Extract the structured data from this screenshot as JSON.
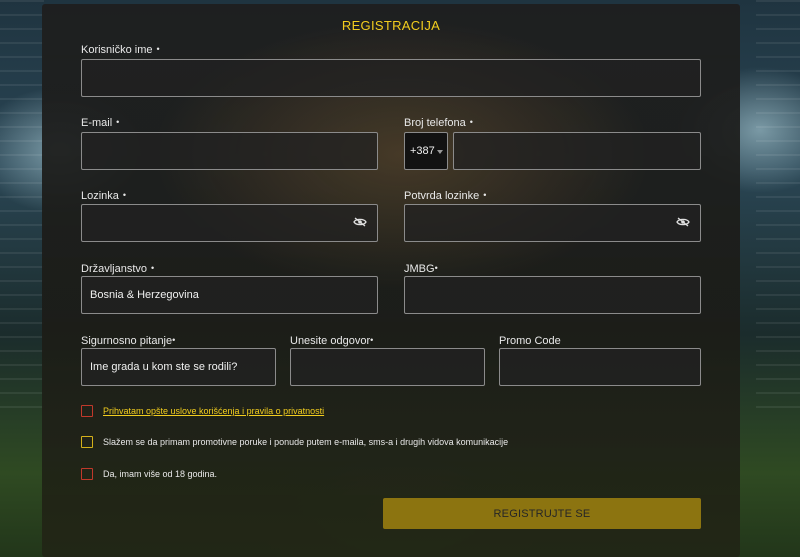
{
  "form": {
    "title": "REGISTRACIJA",
    "username": {
      "label": "Korisničko ime",
      "value": ""
    },
    "email": {
      "label": "E-mail",
      "value": ""
    },
    "phone": {
      "label": "Broj telefona",
      "prefix": "+387",
      "value": ""
    },
    "password": {
      "label": "Lozinka",
      "value": ""
    },
    "password_confirm": {
      "label": "Potvrda lozinke",
      "value": ""
    },
    "citizenship": {
      "label": "Državljanstvo",
      "value": "Bosnia & Herzegovina"
    },
    "jmbg": {
      "label": "JMBG",
      "value": ""
    },
    "security_question": {
      "label": "Sigurnosno pitanje",
      "value": "Ime grada u kom ste se rodili?"
    },
    "answer": {
      "label": "Unesite odgovor",
      "value": ""
    },
    "promo": {
      "label": "Promo Code",
      "value": ""
    },
    "required_mark": "•",
    "checkboxes": [
      {
        "label": "Prihvatam opšte uslove korišćenja i pravila o privatnosti",
        "checked": false,
        "border_color": "#c0392b"
      },
      {
        "label": "Slažem se da primam promotivne poruke i ponude putem e-maila, sms-a i drugih vidova komunikacije",
        "checked": false,
        "border_color": "#d4b11a"
      },
      {
        "label": "Da, imam više od 18 godina.",
        "checked": false,
        "border_color": "#c0392b"
      }
    ],
    "submit_label": "REGISTRUJTE SE"
  },
  "colors": {
    "accent": "#f2cd1e",
    "button": "#8c7410",
    "error": "#c0392b"
  }
}
